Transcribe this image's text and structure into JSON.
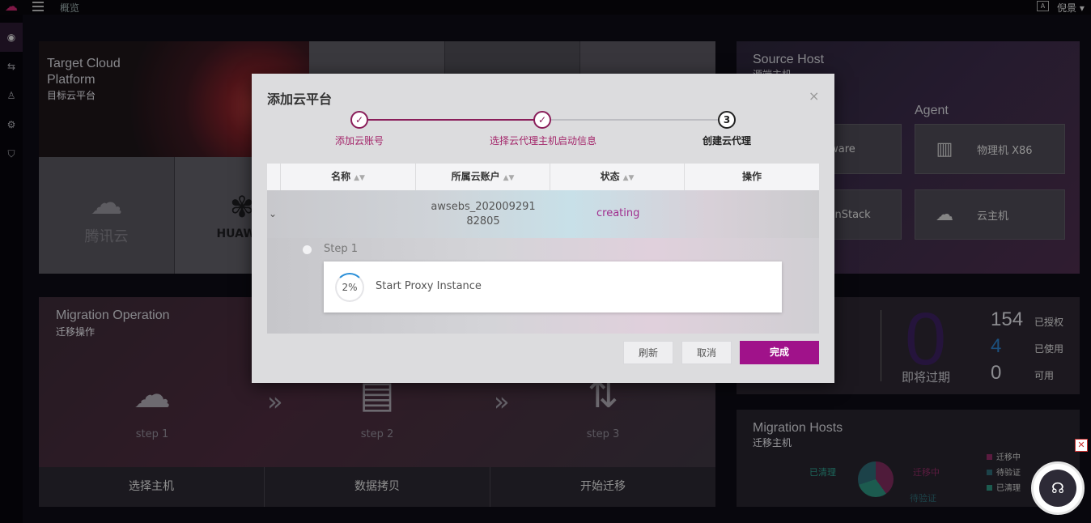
{
  "header": {
    "breadcrumb": "概览",
    "user": "倪景",
    "lang_icon": "A"
  },
  "sidenav": {
    "items": [
      "dashboard-icon",
      "transfer-icon",
      "users-icon",
      "settings-icon",
      "shield-icon"
    ]
  },
  "target": {
    "title_line1": "Target Cloud",
    "title_line2": "Platform",
    "subtitle": "目标云平台",
    "tiles": [
      {
        "name": "腾讯云"
      },
      {
        "name": "HUAWEI"
      }
    ]
  },
  "migration": {
    "title": "Migration Operation",
    "subtitle": "迁移操作",
    "steps": [
      "step 1",
      "step 2",
      "step 3"
    ],
    "actions": [
      "选择主机",
      "数据拷贝",
      "开始迁移"
    ]
  },
  "source": {
    "title": "Source Host",
    "subtitle": "源端主机",
    "agent_label": "Agent",
    "tiles": [
      "VMware",
      "物理机 X86",
      "OpenStack",
      "云主机"
    ]
  },
  "license": {
    "big_value": "0",
    "expire_label": "即将过期",
    "rows": [
      {
        "num": "154",
        "label": "已授权",
        "color": "#d8d8de"
      },
      {
        "num": "4",
        "label": "已使用",
        "color": "#2b7bc2"
      },
      {
        "num": "0",
        "label": "可用",
        "color": "#d8d8de"
      }
    ]
  },
  "hosts": {
    "title": "Migration Hosts",
    "subtitle": "迁移主机",
    "legend": [
      {
        "label": "迁移中",
        "color": "#8a2a62"
      },
      {
        "label": "待验证",
        "color": "#2b6670"
      },
      {
        "label": "已清理",
        "color": "#2b8c7a"
      }
    ],
    "pie_labels": {
      "cleaned": "已清理",
      "migrating": "迁移中",
      "pending": "待验证"
    }
  },
  "modal": {
    "title": "添加云平台",
    "close": "×",
    "steps": [
      {
        "label": "添加云账号",
        "state": "done"
      },
      {
        "label": "选择云代理主机启动信息",
        "state": "done"
      },
      {
        "label": "创建云代理",
        "state": "current",
        "number": "3"
      }
    ],
    "columns": [
      "名称",
      "所属云账户",
      "状态",
      "操作"
    ],
    "row": {
      "account_line1": "awsebs_202009291",
      "account_line2": "82805",
      "status": "creating"
    },
    "detail": {
      "step_name": "Step 1",
      "progress": "2%",
      "task": "Start Proxy Instance"
    },
    "buttons": {
      "refresh": "刷新",
      "cancel": "取消",
      "finish": "完成"
    }
  }
}
